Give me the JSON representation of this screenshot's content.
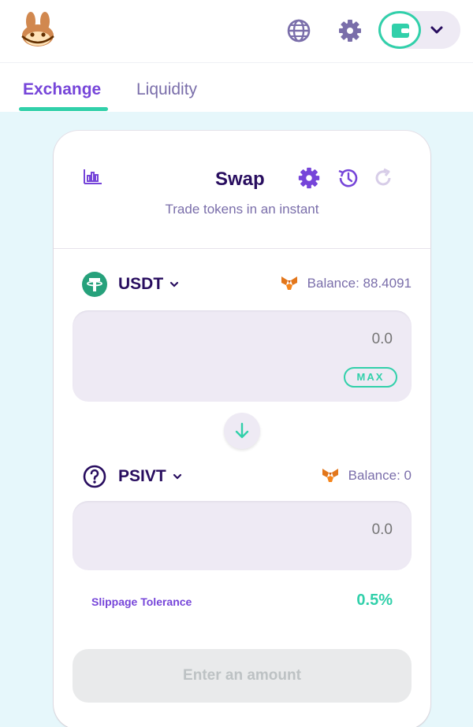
{
  "header": {
    "logo": "pancake-bunny-logo",
    "globe_icon": "globe-icon",
    "settings_icon": "gear-icon",
    "wallet_icon": "wallet-icon",
    "chevron_icon": "chevron-down-icon"
  },
  "tabs": [
    {
      "label": "Exchange",
      "active": true
    },
    {
      "label": "Liquidity",
      "active": false
    }
  ],
  "swap": {
    "title": "Swap",
    "subtitle": "Trade tokens in an instant",
    "from": {
      "symbol": "USDT",
      "balance": "Balance: 88.4091",
      "amount": "0.0",
      "max_label": "MAX"
    },
    "to": {
      "symbol": "PSIVT",
      "balance": "Balance: 0",
      "amount": "0.0"
    },
    "slippage_label": "Slippage Tolerance",
    "slippage_value": "0.5%",
    "submit_label": "Enter an amount"
  },
  "colors": {
    "primary": "#7645d9",
    "teal": "#31d0aa",
    "text": "#280d5f",
    "text_subtle": "#7a6eaa",
    "input_bg": "#eeeaf4",
    "page_bg": "#e6f7fb"
  }
}
